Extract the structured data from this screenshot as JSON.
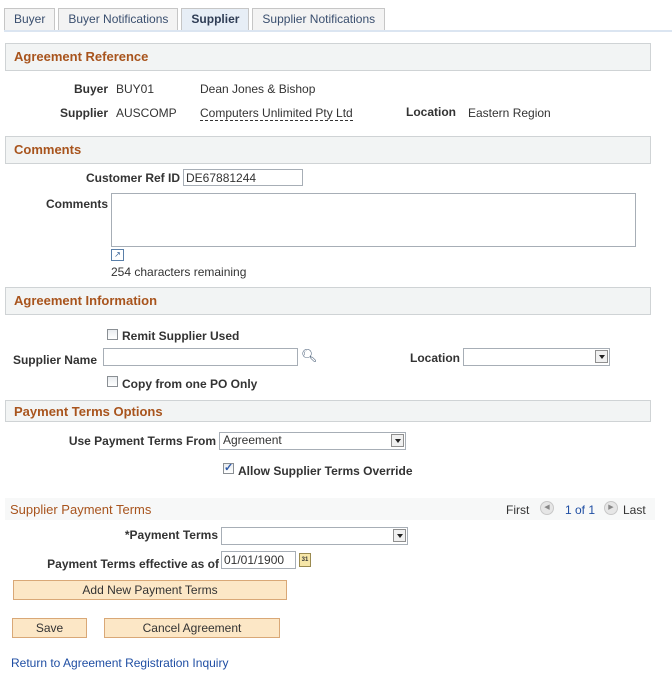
{
  "tabs": [
    {
      "label": "Buyer",
      "active": false
    },
    {
      "label": "Buyer Notifications",
      "active": false
    },
    {
      "label": "Supplier",
      "active": true
    },
    {
      "label": "Supplier Notifications",
      "active": false
    }
  ],
  "agreement_reference": {
    "title": "Agreement Reference",
    "buyer_label": "Buyer",
    "buyer_id": "BUY01",
    "buyer_name": "Dean Jones & Bishop",
    "supplier_label": "Supplier",
    "supplier_id": "AUSCOMP",
    "supplier_name": "Computers Unlimited Pty Ltd",
    "location_label": "Location",
    "location_value": "Eastern Region"
  },
  "comments": {
    "title": "Comments",
    "customer_ref_label": "Customer Ref ID",
    "customer_ref_value": "DE67881244",
    "comments_label": "Comments",
    "comments_value": "",
    "remaining": "254 characters remaining"
  },
  "agreement_information": {
    "title": "Agreement Information",
    "remit_label": "Remit Supplier Used",
    "remit_checked": false,
    "supplier_name_label": "Supplier Name",
    "supplier_name_value": "",
    "location_label": "Location",
    "location_value": "",
    "copy_label": "Copy from one PO Only",
    "copy_checked": false
  },
  "payment_terms_options": {
    "title": "Payment Terms Options",
    "use_from_label": "Use Payment Terms From",
    "use_from_value": "Agreement",
    "allow_override_label": "Allow Supplier Terms Override",
    "allow_override_checked": true
  },
  "supplier_payment_terms": {
    "title": "Supplier Payment Terms",
    "nav_first": "First",
    "nav_count": "1 of 1",
    "nav_last": "Last",
    "payment_terms_label": "*Payment Terms",
    "payment_terms_value": "",
    "effective_label": "Payment Terms effective as of",
    "effective_value": "01/01/1900",
    "add_button": "Add New Payment Terms"
  },
  "actions": {
    "save": "Save",
    "cancel": "Cancel Agreement",
    "return_link": "Return to Agreement Registration Inquiry"
  }
}
